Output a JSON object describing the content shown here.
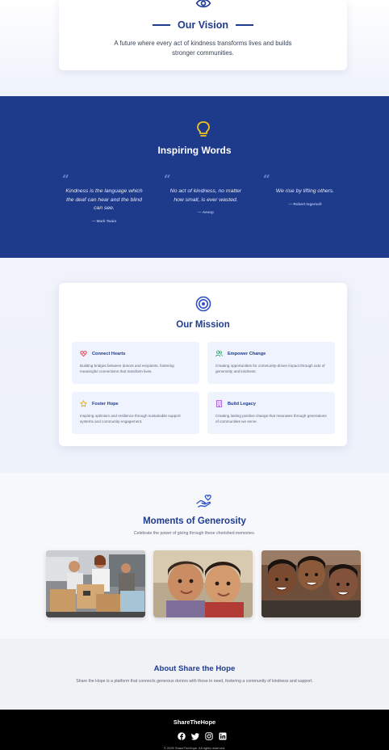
{
  "vision": {
    "title": "Our Vision",
    "description": "A future where every act of kindness transforms lives and builds stronger communities."
  },
  "inspiring": {
    "title": "Inspiring Words",
    "quotes": [
      {
        "mark": "“",
        "text": "Kindness is the language which the deaf can hear and the blind can see.",
        "author": "— Mark Twain"
      },
      {
        "mark": "“",
        "text": "No act of kindness, no matter how small, is ever wasted.",
        "author": "— Aesop"
      },
      {
        "mark": "“",
        "text": "We rise by lifting others.",
        "author": "— Robert Ingersoll"
      }
    ]
  },
  "mission": {
    "title": "Our Mission",
    "items": [
      {
        "icon": "heart-handshake-icon",
        "title": "Connect Hearts",
        "description": "Building bridges between donors and recipients, fostering meaningful connections that transform lives."
      },
      {
        "icon": "people-icon",
        "title": "Empower Change",
        "description": "Creating opportunities for community-driven impact through acts of generosity and kindness."
      },
      {
        "icon": "star-icon",
        "title": "Foster Hope",
        "description": "Inspiring optimism and resilience through sustainable support systems and community engagement."
      },
      {
        "icon": "building-icon",
        "title": "Build Legacy",
        "description": "Creating lasting positive change that resonates through generations of communities we serve."
      }
    ]
  },
  "moments": {
    "title": "Moments of Generosity",
    "subtitle": "Celebrate the power of giving through these cherished memories.",
    "photos": [
      {
        "name": "volunteers-packing-photo"
      },
      {
        "name": "two-children-photo"
      },
      {
        "name": "smiling-kids-photo"
      }
    ]
  },
  "about": {
    "title": "About Share the Hope",
    "description": "Share the Hope is a platform that connects generous donors with those in need, fostering a community of kindness and support."
  },
  "footer": {
    "brand": "ShareTheHope",
    "socials": [
      "facebook-icon",
      "twitter-icon",
      "instagram-icon",
      "linkedin-icon"
    ],
    "copyright": "© 2025 ShareTheHope. All rights reserved."
  },
  "colors": {
    "primary": "#1f3b91",
    "quotes_bg": "#1e3a8a",
    "accent_yellow": "#f5c518",
    "footer_bg": "#000000"
  }
}
